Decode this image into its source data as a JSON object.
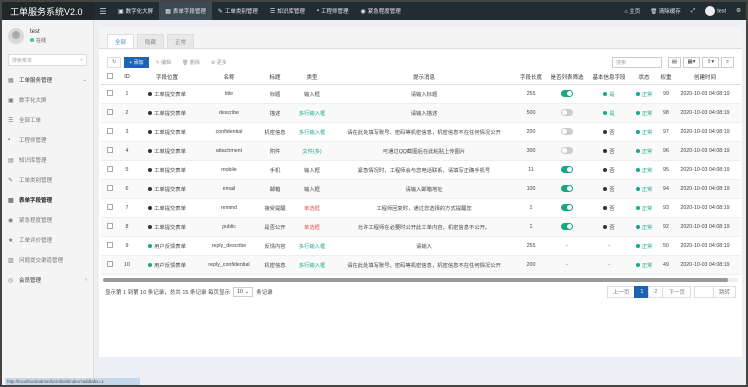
{
  "app": {
    "title": "工单服务系统V2.0"
  },
  "topnav": [
    {
      "label": "数字化大屏",
      "icon": "dashboard-icon",
      "glyph": "▣"
    },
    {
      "label": "表单字段管理",
      "icon": "table-icon",
      "glyph": "▦"
    },
    {
      "label": "工单类别管理",
      "icon": "tag-icon",
      "glyph": "✎"
    },
    {
      "label": "知识库管理",
      "icon": "book-icon",
      "glyph": "☰"
    },
    {
      "label": "工程师管理",
      "icon": "user-icon",
      "glyph": "▪"
    },
    {
      "label": "紧急程度管理",
      "icon": "alert-icon",
      "glyph": "◉"
    }
  ],
  "topright": {
    "home": "主页",
    "clear_cache": "清除缓存",
    "user": "test"
  },
  "user": {
    "name": "test",
    "status": "在线"
  },
  "sidebar": {
    "search_placeholder": "搜索菜单",
    "items": [
      {
        "label": "工单服务管理",
        "icon": "grid-icon",
        "type": "head",
        "arrow": "⌄"
      },
      {
        "label": "数字化大屏",
        "icon": "dashboard-icon",
        "type": "sub"
      },
      {
        "label": "全部工单",
        "icon": "list-icon",
        "type": "sub"
      },
      {
        "label": "工程师管理",
        "icon": "user-icon",
        "type": "sub"
      },
      {
        "label": "知识库管理",
        "icon": "book-icon",
        "type": "sub"
      },
      {
        "label": "工单类别管理",
        "icon": "tag-icon",
        "type": "sub"
      },
      {
        "label": "表单字段管理",
        "icon": "table-icon",
        "type": "bold"
      },
      {
        "label": "紧急程度管理",
        "icon": "alert-icon",
        "type": "sub"
      },
      {
        "label": "工单评价管理",
        "icon": "star-icon",
        "type": "sub"
      },
      {
        "label": "问题提交渠道管理",
        "icon": "channel-icon",
        "type": "sub"
      },
      {
        "label": "会员管理",
        "icon": "member-icon",
        "type": "head",
        "arrow": "‹"
      }
    ]
  },
  "tabs": [
    "全部",
    "隐藏",
    "正常"
  ],
  "toolbar": {
    "refresh": "↻",
    "add": "+ 添加",
    "edit": "✎ 编辑",
    "delete": "🗑 删除",
    "more": "⚙ 更多",
    "search_placeholder": "搜索"
  },
  "columns": [
    "",
    "ID",
    "字段位置",
    "名称",
    "标题",
    "类型",
    "提示消息",
    "字段长度",
    "是否列表筛选",
    "基本信息字段",
    "状态",
    "权重",
    "创建时间",
    ""
  ],
  "rows": [
    {
      "id": "1",
      "pos": "工单提交表单",
      "pos_color": "dark",
      "name": "title",
      "title": "标题",
      "type": "输入框",
      "type_color": "",
      "tip": "请输入标题",
      "len": "255",
      "filter": "on",
      "basic": "是",
      "basic_color": "green",
      "status": "正常",
      "weight": "99",
      "time": "2020-10-03 04:08:19"
    },
    {
      "id": "2",
      "pos": "工单提交表单",
      "pos_color": "dark",
      "name": "describe",
      "title": "描述",
      "type": "多行输入框",
      "type_color": "green",
      "tip": "请输入描述",
      "len": "500",
      "filter": "off",
      "basic": "是",
      "basic_color": "green",
      "status": "正常",
      "weight": "98",
      "time": "2020-10-03 04:08:19"
    },
    {
      "id": "3",
      "pos": "工单提交表单",
      "pos_color": "dark",
      "name": "confidential",
      "title": "机密信息",
      "type": "多行输入框",
      "type_color": "green",
      "tip": "请在此处填写账号、密码等机密信息，机密信息不在任何情况公开",
      "len": "200",
      "filter": "off",
      "basic": "否",
      "basic_color": "dark",
      "status": "正常",
      "weight": "97",
      "time": "2020-10-03 04:08:19"
    },
    {
      "id": "4",
      "pos": "工单提交表单",
      "pos_color": "dark",
      "name": "attachment",
      "title": "附件",
      "type": "文件(多)",
      "type_color": "green",
      "tip": "可通过QQ截图后在此粘贴上传图片",
      "len": "300",
      "filter": "off",
      "basic": "否",
      "basic_color": "dark",
      "status": "正常",
      "weight": "96",
      "time": "2020-10-03 04:08:19"
    },
    {
      "id": "5",
      "pos": "工单提交表单",
      "pos_color": "dark",
      "name": "mobile",
      "title": "手机",
      "type": "输入框",
      "type_color": "",
      "tip": "紧急情况时，工程师会与您电话联系，请填写正确手机号",
      "len": "11",
      "filter": "on",
      "basic": "否",
      "basic_color": "dark",
      "status": "正常",
      "weight": "95",
      "time": "2020-10-03 04:08:19"
    },
    {
      "id": "6",
      "pos": "工单提交表单",
      "pos_color": "dark",
      "name": "email",
      "title": "邮箱",
      "type": "输入框",
      "type_color": "",
      "tip": "请输入邮箱地址",
      "len": "100",
      "filter": "on",
      "basic": "否",
      "basic_color": "dark",
      "status": "正常",
      "weight": "94",
      "time": "2020-10-03 04:08:19"
    },
    {
      "id": "7",
      "pos": "工单提交表单",
      "pos_color": "dark",
      "name": "remind",
      "title": "接受提醒",
      "type": "单选框",
      "type_color": "red",
      "tip": "工程师回复时，通过您选择的方式提醒您",
      "len": "1",
      "filter": "on",
      "basic": "否",
      "basic_color": "dark",
      "status": "正常",
      "weight": "93",
      "time": "2020-10-03 04:08:19"
    },
    {
      "id": "8",
      "pos": "工单提交表单",
      "pos_color": "dark",
      "name": "public",
      "title": "是否公开",
      "type": "单选框",
      "type_color": "red",
      "tip": "允许工程师在必要时公开此工单内容，机密信息不公开。",
      "len": "1",
      "filter": "on",
      "basic": "否",
      "basic_color": "dark",
      "status": "正常",
      "weight": "92",
      "time": "2020-10-03 04:08:19"
    },
    {
      "id": "9",
      "pos": "用户反馈表单",
      "pos_color": "green",
      "name": "reply_describe",
      "title": "反馈内容",
      "type": "多行输入框",
      "type_color": "green",
      "tip": "请输入",
      "len": "255",
      "filter": "-",
      "basic": "-",
      "basic_color": "",
      "status": "正常",
      "weight": "50",
      "time": "2020-10-03 04:08:19"
    },
    {
      "id": "10",
      "pos": "用户反馈表单",
      "pos_color": "green",
      "name": "reply_confidential",
      "title": "机密信息",
      "type": "多行输入框",
      "type_color": "green",
      "tip": "请在此处填写账号、密码等机密信息，机密信息不在任何情况公开",
      "len": "200",
      "filter": "-",
      "basic": "-",
      "basic_color": "",
      "status": "正常",
      "weight": "49",
      "time": "2020-10-03 04:08:19"
    }
  ],
  "footer": {
    "summary": "显示第 1 到第 10 条记录，总共 15 条记录 每页显示",
    "page_size": "10 ⌄",
    "suffix": "条记录",
    "prev": "上一页",
    "pages": [
      "1",
      "2"
    ],
    "next": "下一页",
    "jump": "跳转"
  },
  "statusbar": "http://localhost/admin/formfield/index?addtabs=1"
}
